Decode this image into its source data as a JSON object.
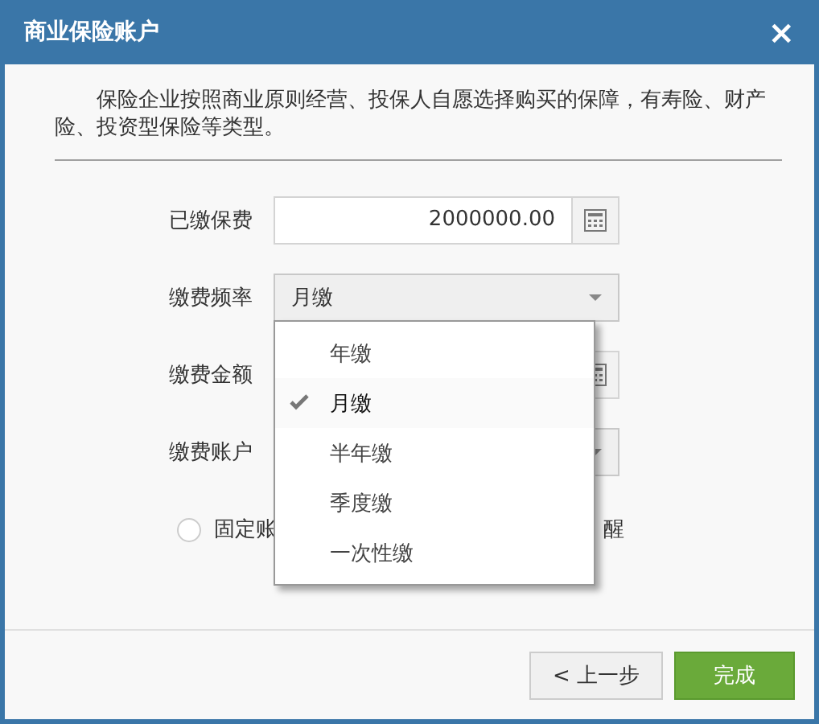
{
  "window": {
    "title": "商业保险账户",
    "close": "×"
  },
  "description": "保险企业按照商业原则经营、投保人自愿选择购买的保障，有寿险、财产险、投资型保险等类型。",
  "form": {
    "rows": [
      {
        "label": "已缴保费",
        "kind": "number",
        "value": "2000000.00"
      },
      {
        "label": "缴费频率",
        "kind": "select",
        "value": "月缴",
        "expanded": true
      },
      {
        "label": "缴费金额",
        "kind": "number"
      },
      {
        "label": "缴费账户",
        "kind": "select",
        "expanded": false
      }
    ],
    "radio": {
      "selected": false,
      "label_start": "固定账",
      "label_end": "醒"
    }
  },
  "dropdown": {
    "items": [
      {
        "label": "年缴",
        "selected": false
      },
      {
        "label": "月缴",
        "selected": true
      },
      {
        "label": "半年缴",
        "selected": false
      },
      {
        "label": "季度缴",
        "selected": false
      },
      {
        "label": "一次性缴",
        "selected": false
      }
    ]
  },
  "buttons": [
    {
      "label": "< 上一步",
      "kind": "secondary"
    },
    {
      "label": "完成",
      "kind": "primary"
    }
  ]
}
